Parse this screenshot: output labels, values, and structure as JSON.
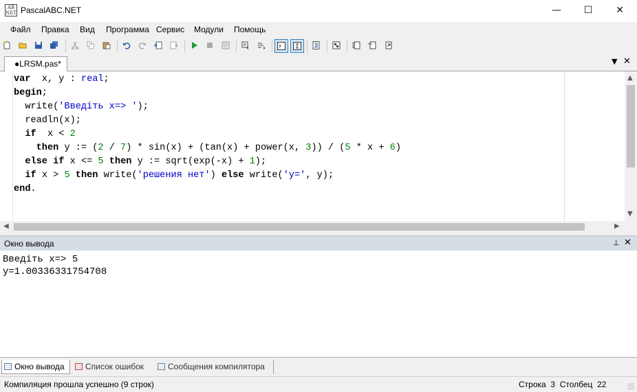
{
  "window": {
    "title": "PascalABC.NET",
    "icon_text": "AB\nNET",
    "minimize": "—",
    "maximize": "☐",
    "close": "✕"
  },
  "menu": [
    "Файл",
    "Правка",
    "Вид",
    "Программа",
    "Сервис",
    "Модули",
    "Помощь"
  ],
  "toolbar_icons": [
    "new-file-icon",
    "open-folder-icon",
    "save-icon",
    "save-all-icon",
    "cut-icon",
    "copy-icon",
    "paste-icon",
    "undo-icon",
    "redo-icon",
    "navigate-back-icon",
    "navigate-forward-icon",
    "run-icon",
    "stop-icon",
    "compile-icon",
    "output-window-icon",
    "autocomplete-icon",
    "console-window-icon",
    "text-window-icon",
    "format-code-icon",
    "debug-icon",
    "step-over-icon",
    "step-into-icon",
    "step-out-icon"
  ],
  "tabs": {
    "active_file": "●LRSM.pas*",
    "dropdown": "▼",
    "close": "✕"
  },
  "editor": {
    "lines": [
      [
        [
          "kw",
          "var"
        ],
        [
          "",
          "  x, y : "
        ],
        [
          "tp",
          "real"
        ],
        [
          "",
          ";"
        ]
      ],
      [
        [
          "kw",
          "begin"
        ],
        [
          "",
          ";"
        ]
      ],
      [
        [
          "",
          "  write("
        ],
        [
          "st",
          "'Введіть x=> '"
        ],
        [
          "",
          ");"
        ]
      ],
      [
        [
          "",
          "  readln(x);"
        ]
      ],
      [
        [
          "",
          "  "
        ],
        [
          "kw",
          "if"
        ],
        [
          "",
          "  x < "
        ],
        [
          "nm",
          "2"
        ]
      ],
      [
        [
          "",
          "    "
        ],
        [
          "kw",
          "then"
        ],
        [
          "",
          " y := ("
        ],
        [
          "nm",
          "2"
        ],
        [
          "",
          " / "
        ],
        [
          "nm",
          "7"
        ],
        [
          "",
          ") * sin(x) + (tan(x) + power(x, "
        ],
        [
          "nm",
          "3"
        ],
        [
          "",
          ")) / ("
        ],
        [
          "nm",
          "5"
        ],
        [
          "",
          " * x + "
        ],
        [
          "nm",
          "6"
        ],
        [
          "",
          ")"
        ]
      ],
      [
        [
          "",
          "  "
        ],
        [
          "kw",
          "else"
        ],
        [
          "",
          " "
        ],
        [
          "kw",
          "if"
        ],
        [
          "",
          " x <= "
        ],
        [
          "nm",
          "5"
        ],
        [
          "",
          " "
        ],
        [
          "kw",
          "then"
        ],
        [
          "",
          " y := sqrt(exp(-x) + "
        ],
        [
          "nm",
          "1"
        ],
        [
          "",
          ");"
        ]
      ],
      [
        [
          "",
          "  "
        ],
        [
          "kw",
          "if"
        ],
        [
          "",
          " x > "
        ],
        [
          "nm",
          "5"
        ],
        [
          "",
          " "
        ],
        [
          "kw",
          "then"
        ],
        [
          "",
          " write("
        ],
        [
          "st",
          "'решения нет'"
        ],
        [
          "",
          ") "
        ],
        [
          "kw",
          "else"
        ],
        [
          "",
          " write("
        ],
        [
          "st",
          "'y='"
        ],
        [
          "",
          ", y);"
        ]
      ],
      [
        [
          "kw",
          "end"
        ],
        [
          "",
          "."
        ]
      ]
    ]
  },
  "output": {
    "title": "Окно вывода",
    "pin": "📌",
    "close": "✕",
    "lines": [
      "Введіть x=> 5",
      "y=1.00336331754708"
    ]
  },
  "bottom_tabs": [
    "Окно вывода",
    "Список ошибок",
    "Сообщения компилятора"
  ],
  "status": {
    "message": "Компиляция прошла успешно (9 строк)",
    "position": "Строка  3  Столбец  22"
  }
}
